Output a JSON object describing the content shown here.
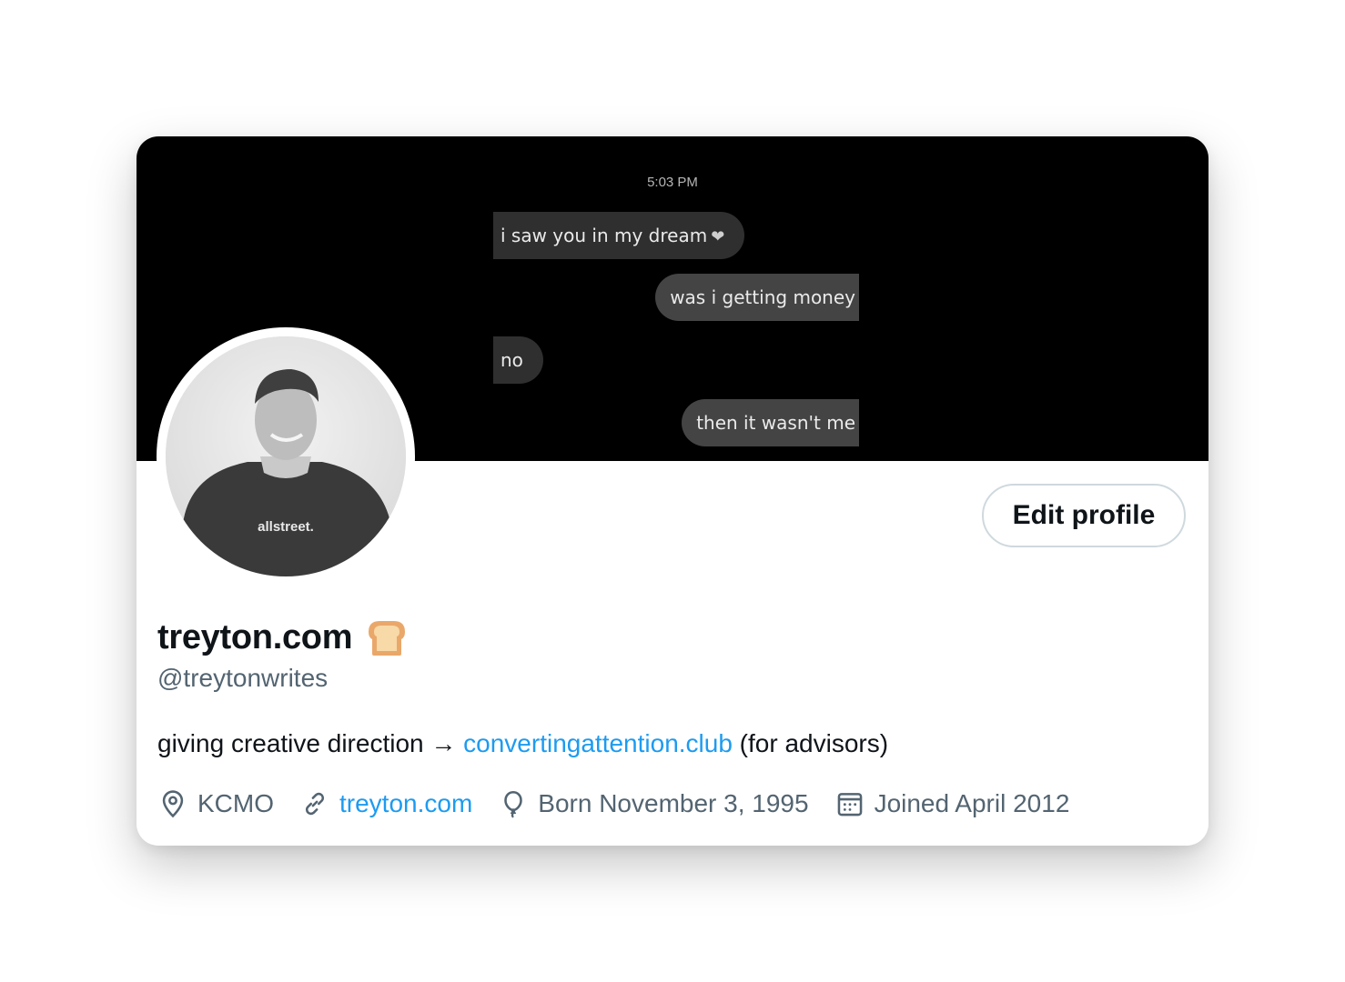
{
  "banner": {
    "timestamp": "5:03 PM",
    "messages": [
      {
        "text": "i saw you in my dream",
        "side": "in",
        "emoji": "heart-icon"
      },
      {
        "text": "was i getting money",
        "side": "out"
      },
      {
        "text": "no",
        "side": "in"
      },
      {
        "text": "then it wasn't me",
        "side": "out"
      }
    ]
  },
  "avatar": {
    "shirt_text": "allstreet."
  },
  "actions": {
    "edit_profile_label": "Edit profile"
  },
  "profile": {
    "display_name": "treyton.com",
    "name_emoji": "bread-icon",
    "handle": "@treytonwrites",
    "bio": {
      "prefix": "giving creative direction → ",
      "link": "convertingattention.club",
      "suffix": " (for advisors)"
    },
    "location": "KCMO",
    "website": "treyton.com",
    "birthday": "Born November 3, 1995",
    "joined": "Joined April 2012"
  },
  "colors": {
    "link": "#1d9bf0",
    "secondary_text": "#536471",
    "primary_text": "#0f1419",
    "button_border": "#cfd9de"
  }
}
